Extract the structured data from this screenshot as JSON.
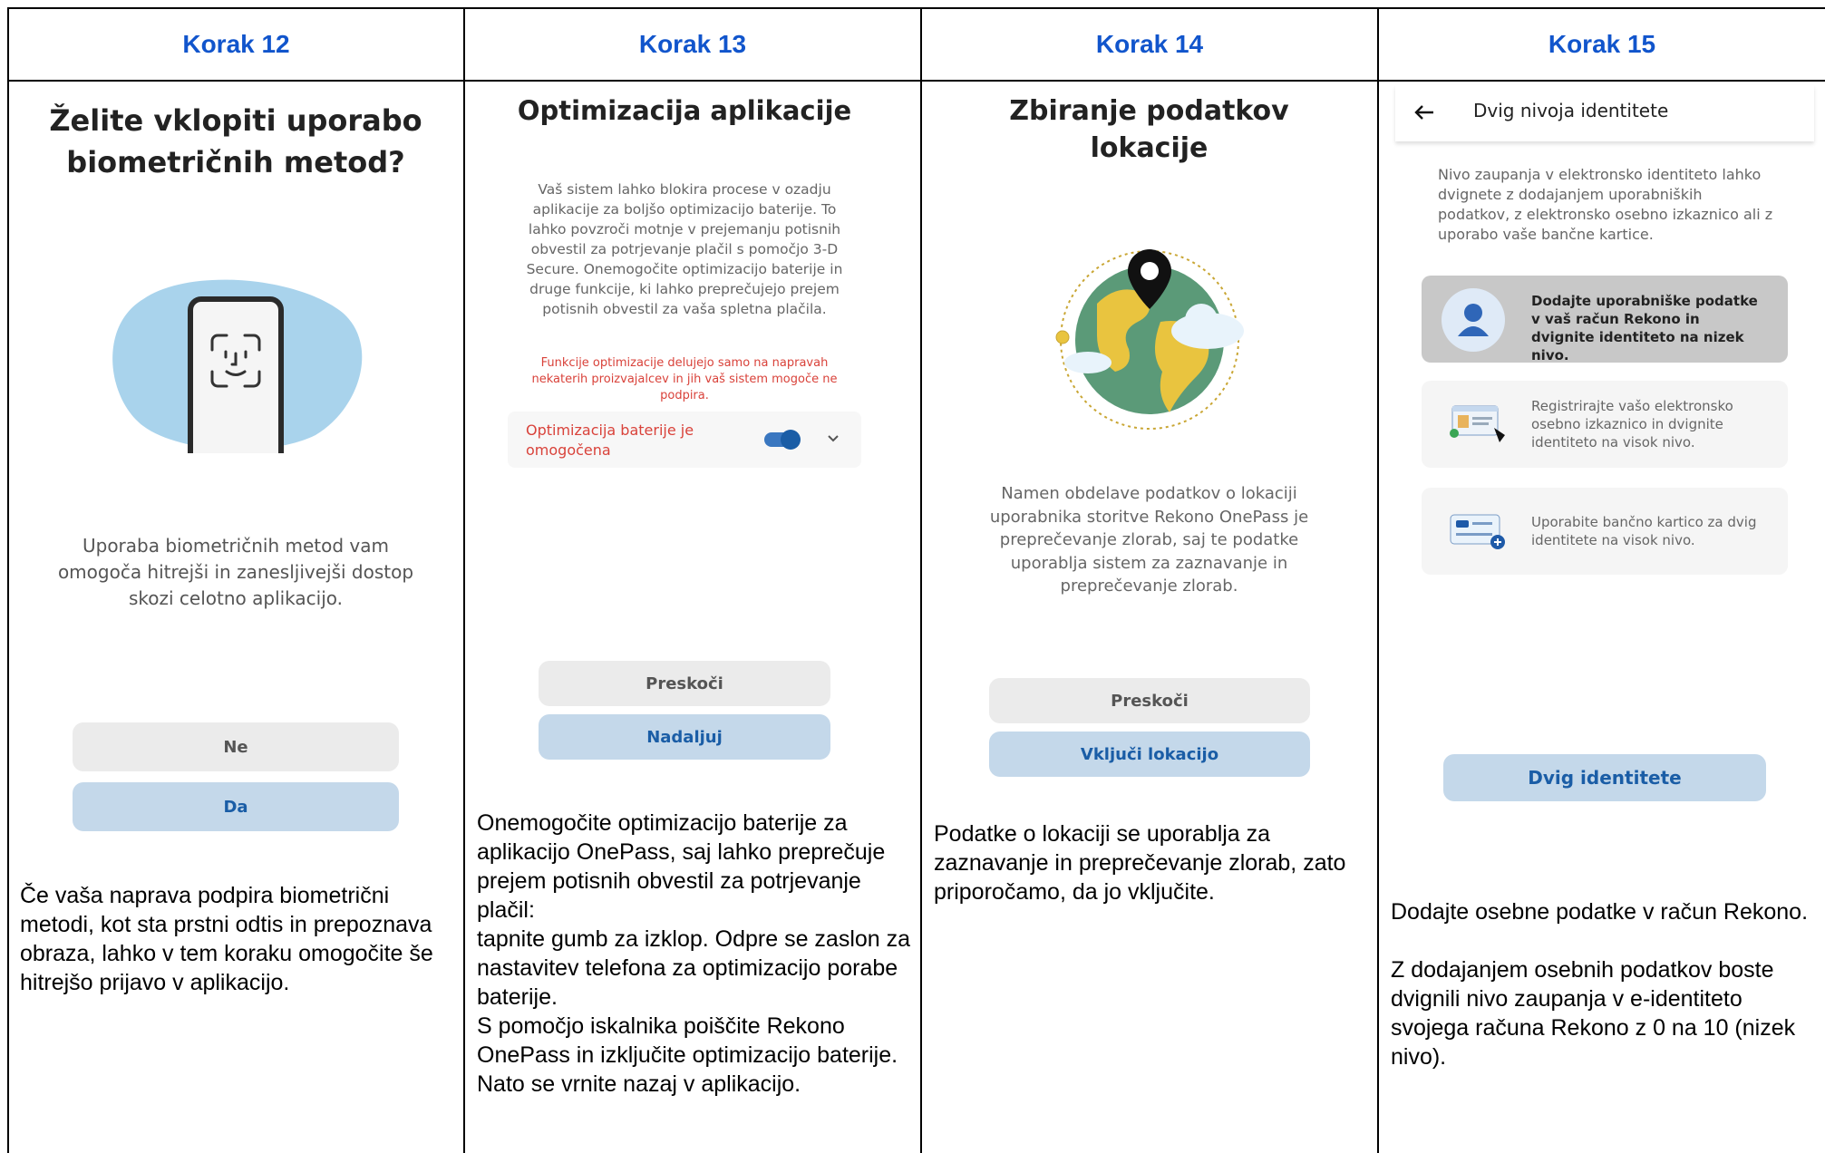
{
  "headers": [
    "Korak 12",
    "Korak 13",
    "Korak 14",
    "Korak 15"
  ],
  "step12": {
    "title": "Želite vklopiti uporabo biometričnih metod?",
    "description": "Uporaba biometričnih metod vam omogoča hitrejši in zanesljivejši dostop skozi celotno aplikacijo.",
    "button_no": "Ne",
    "button_yes": "Da",
    "note": "Če vaša naprava podpira biometrični metodi, kot sta prstni odtis in prepoznava obraza, lahko v tem koraku omogočite še hitrejšo prijavo v aplikacijo."
  },
  "step13": {
    "title": "Optimizacija aplikacije",
    "description": "Vaš sistem lahko blokira procese v ozadju aplikacije za boljšo optimizacijo baterije. To lahko povzroči motnje v prejemanju potisnih obvestil za potrjevanje plačil s pomočjo 3-D Secure. Onemogočite optimizacijo baterije in druge funkcije, ki lahko preprečujejo prejem potisnih obvestil za vaša spletna plačila.",
    "warning": "Funkcije optimizacije delujejo samo na napravah nekaterih proizvajalcev in jih vaš sistem mogoče ne podpira.",
    "toggle_label": "Optimizacija baterije je omogočena",
    "toggle_on": true,
    "button_skip": "Preskoči",
    "button_continue": "Nadaljuj",
    "note_lines": [
      "Onemogočite optimizacijo baterije za aplikacijo OnePass, saj lahko preprečuje prejem potisnih obvestil za potrjevanje plačil:",
      "tapnite gumb za izklop. Odpre se zaslon za nastavitev telefona za optimizacijo porabe baterije.",
      "S pomočjo iskalnika poiščite Rekono OnePass in izključite optimizacijo baterije. Nato se vrnite nazaj v aplikacijo."
    ]
  },
  "step14": {
    "title": "Zbiranje podatkov lokacije",
    "description": "Namen obdelave podatkov o lokaciji uporabnika storitve Rekono OnePass je preprečevanje zlorab, saj te podatke uporablja sistem za zaznavanje in preprečevanje zlorab.",
    "button_skip": "Preskoči",
    "button_enable": "Vključi lokacijo",
    "note": "Podatke o lokaciji se uporablja za zaznavanje in preprečevanje zlorab, zato priporočamo, da jo vključite."
  },
  "step15": {
    "appbar_title": "Dvig nivoja identitete",
    "intro": "Nivo zaupanja v elektronsko identiteto lahko dvignete z dodajanjem uporabniških podatkov, z elektronsko osebno izkaznico ali z uporabo vaše bančne kartice.",
    "option1": "Dodajte uporabniške podatke v vaš račun Rekono in dvignite identiteto na nizek nivo.",
    "option2": "Registrirajte vašo elektronsko osebno izkaznico in dvignite identiteto na visok nivo.",
    "option3": "Uporabite bančno kartico za dvig identitete na visok nivo.",
    "button_raise": "Dvig identitete",
    "note_p1": "Dodajte osebne podatke v račun Rekono.",
    "note_p2": "Z dodajanjem osebnih podatkov boste dvignili nivo zaupanja v e-identiteto svojega računa Rekono z 0 na 10 (nizek nivo)."
  },
  "colors": {
    "header_blue": "#1155cc",
    "button_blue_bg": "#c4d8ea",
    "button_blue_text": "#1a5da6",
    "button_grey_bg": "#ebebeb",
    "warning_red": "#d9423a",
    "toggle_blue": "#1a5da6",
    "option_selected_bg": "#c8c8c8",
    "blob_blue": "#a9d3ec",
    "globe_green": "#5b9a78",
    "globe_yellow": "#e9c43f"
  }
}
